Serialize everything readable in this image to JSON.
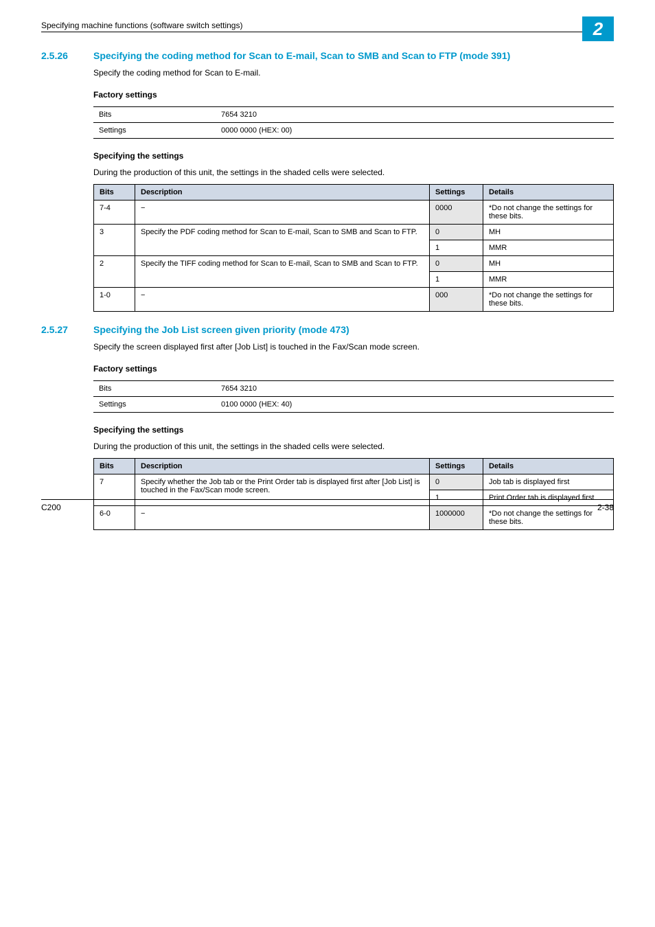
{
  "header": {
    "breadcrumb": "Specifying machine functions (software switch settings)",
    "chapter": "2"
  },
  "s2526": {
    "num": "2.5.26",
    "title": "Specifying the coding method for Scan to E-mail, Scan to SMB and Scan to FTP (mode 391)",
    "intro": "Specify the coding method for Scan to E-mail.",
    "factory_heading": "Factory settings",
    "factory": {
      "bits_label": "Bits",
      "bits_value": "7654 3210",
      "settings_label": "Settings",
      "settings_value": "0000 0000 (HEX: 00)"
    },
    "specifying_heading": "Specifying the settings",
    "specifying_intro": "During the production of this unit, the settings in the shaded cells were selected.",
    "table": {
      "headers": {
        "bits": "Bits",
        "desc": "Description",
        "set": "Settings",
        "det": "Details"
      },
      "r1": {
        "bits": "7-4",
        "desc": "−",
        "set": "0000",
        "det": "*Do not change the settings for these bits."
      },
      "r2": {
        "bits": "3",
        "desc": "Specify the PDF coding method for Scan to E-mail, Scan to SMB and Scan to FTP.",
        "set0": "0",
        "det0": "MH",
        "set1": "1",
        "det1": "MMR"
      },
      "r3": {
        "bits": "2",
        "desc": "Specify the TIFF coding method for Scan to E-mail, Scan to SMB and Scan to FTP.",
        "set0": "0",
        "det0": "MH",
        "set1": "1",
        "det1": "MMR"
      },
      "r4": {
        "bits": "1-0",
        "desc": "−",
        "set": "000",
        "det": "*Do not change the settings for these bits."
      }
    }
  },
  "s2527": {
    "num": "2.5.27",
    "title": "Specifying the Job List screen given priority (mode 473)",
    "intro": "Specify the screen displayed first after [Job List] is touched in the Fax/Scan mode screen.",
    "factory_heading": "Factory settings",
    "factory": {
      "bits_label": "Bits",
      "bits_value": "7654 3210",
      "settings_label": "Settings",
      "settings_value": "0100 0000 (HEX: 40)"
    },
    "specifying_heading": "Specifying the settings",
    "specifying_intro": "During the production of this unit, the settings in the shaded cells were selected.",
    "table": {
      "headers": {
        "bits": "Bits",
        "desc": "Description",
        "set": "Settings",
        "det": "Details"
      },
      "r1": {
        "bits": "7",
        "desc": "Specify whether the Job tab or the Print Order tab is displayed first after [Job List] is touched in the Fax/Scan mode screen.",
        "set0": "0",
        "det0": "Job tab is displayed first",
        "set1": "1",
        "det1": "Print Order tab is displayed first"
      },
      "r2": {
        "bits": "6-0",
        "desc": "−",
        "set": "1000000",
        "det": "*Do not change the settings for these bits."
      }
    }
  },
  "footer": {
    "left": "C200",
    "right": "2-38"
  }
}
